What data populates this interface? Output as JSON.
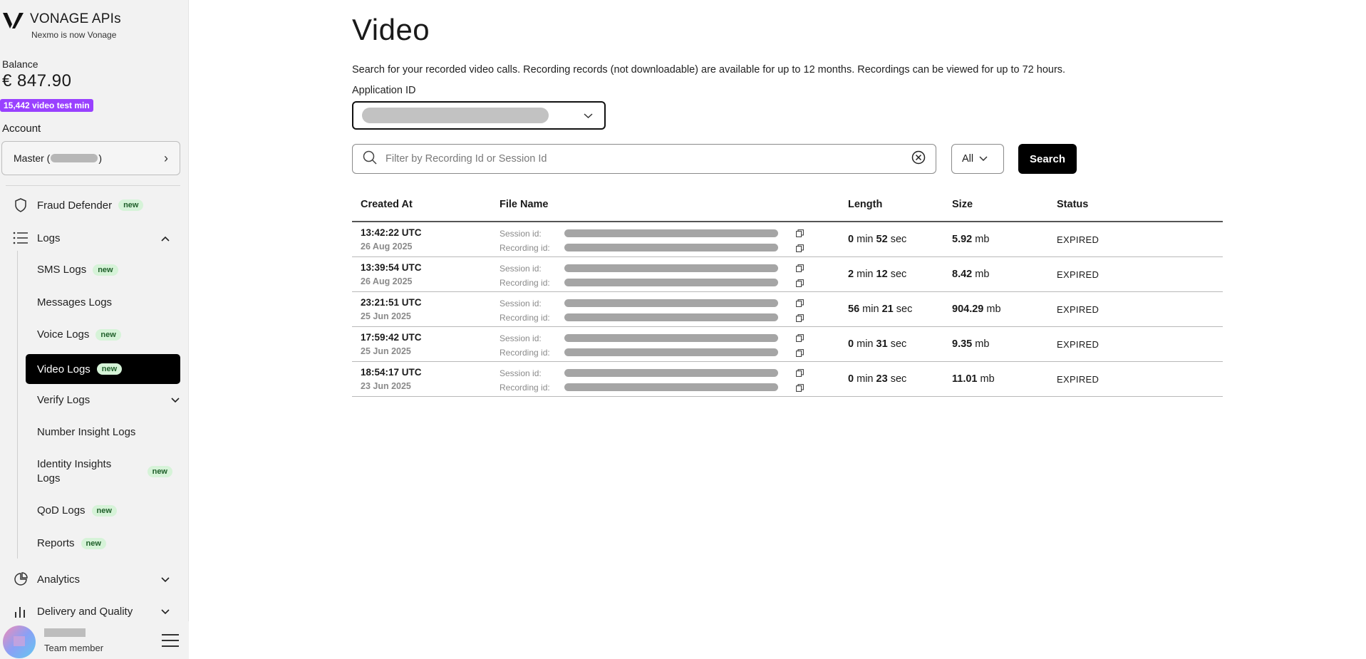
{
  "brand": {
    "name": "VONAGE APIs",
    "subtitle": "Nexmo is now Vonage"
  },
  "balance": {
    "label": "Balance",
    "value": "€ 847.90",
    "badge": "15,442 video test min"
  },
  "account": {
    "label": "Account",
    "prefix": "Master (",
    "suffix": ")"
  },
  "nav": {
    "fraud_defender": "Fraud Defender",
    "logs": "Logs",
    "analytics": "Analytics",
    "delivery": "Delivery and Quality",
    "new_tag": "new",
    "sub": {
      "sms": "SMS Logs",
      "messages": "Messages Logs",
      "voice": "Voice Logs",
      "video": "Video Logs",
      "verify": "Verify Logs",
      "number_insight": "Number Insight Logs",
      "identity_line1": "Identity Insights",
      "identity_line2": "Logs",
      "qod": "QoD Logs",
      "reports": "Reports"
    }
  },
  "user": {
    "role": "Team member"
  },
  "page": {
    "title": "Video",
    "description": "Search for your recorded video calls. Recording records (not downloadable) are available for up to 12 months. Recordings can be viewed for up to 72 hours.",
    "app_id_label": "Application ID"
  },
  "search": {
    "placeholder": "Filter by Recording Id or Session Id",
    "filter_value": "All",
    "button": "Search"
  },
  "table": {
    "headers": {
      "created": "Created At",
      "file": "File Name",
      "length": "Length",
      "size": "Size",
      "status": "Status"
    },
    "session_label": "Session id:",
    "recording_label": "Recording id:",
    "rows": [
      {
        "time": "13:42:22 UTC",
        "date": "26 Aug 2025",
        "len_min": "0",
        "len_sec": "52",
        "size": "5.92",
        "status": "EXPIRED"
      },
      {
        "time": "13:39:54 UTC",
        "date": "26 Aug 2025",
        "len_min": "2",
        "len_sec": "12",
        "size": "8.42",
        "status": "EXPIRED"
      },
      {
        "time": "23:21:51 UTC",
        "date": "25 Jun 2025",
        "len_min": "56",
        "len_sec": "21",
        "size": "904.29",
        "status": "EXPIRED"
      },
      {
        "time": "17:59:42 UTC",
        "date": "25 Jun 2025",
        "len_min": "0",
        "len_sec": "31",
        "size": "9.35",
        "status": "EXPIRED"
      },
      {
        "time": "18:54:17 UTC",
        "date": "23 Jun 2025",
        "len_min": "0",
        "len_sec": "23",
        "size": "11.01",
        "status": "EXPIRED"
      }
    ],
    "unit_min": "min",
    "unit_sec": "sec",
    "unit_size": "mb"
  }
}
